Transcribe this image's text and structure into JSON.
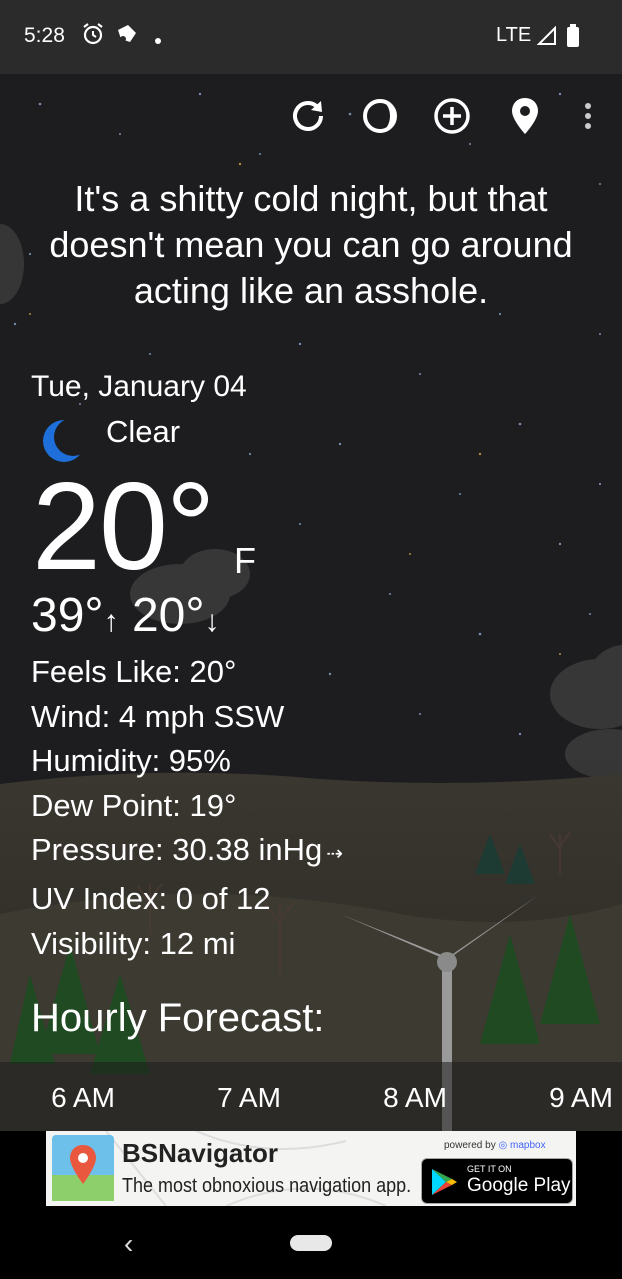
{
  "status_bar": {
    "time": "5:28",
    "network": "LTE",
    "icons": [
      "alarm-icon",
      "cast-icon",
      "dot-icon",
      "signal-icon",
      "battery-icon"
    ]
  },
  "toolbar": {
    "icons": [
      "refresh-icon",
      "theme-icon",
      "add-location-icon",
      "location-pin-icon",
      "more-vert-icon"
    ]
  },
  "quote": "It's a shitty cold night, but that doesn't mean you can go around acting like an asshole.",
  "current": {
    "date": "Tue, January 04",
    "condition": "Clear",
    "condition_icon": "moon-icon",
    "temperature": "20°",
    "unit": "F",
    "high": "39°",
    "low": "20°"
  },
  "details": [
    "Feels Like:  20°",
    "Wind:  4 mph SSW",
    "Humidity:  95%",
    "Dew Point:  19°",
    "Pressure:  30.38 inHg",
    "UV Index:  0 of 12",
    "Visibility:  12 mi"
  ],
  "pressure_trend_icon": "arrow-right-icon",
  "hourly": {
    "title": "Hourly Forecast:",
    "hours": [
      "6 AM",
      "7 AM",
      "8 AM",
      "9 AM"
    ]
  },
  "ad": {
    "name": "BSNavigator",
    "tagline": "The most obnoxious navigation app.",
    "powered_by": "powered by",
    "mapbox": "mapbox",
    "play_small": "GET IT ON",
    "play_big": "Google Play"
  },
  "colors": {
    "status_bar": "#2b2b2b",
    "sky": "#1d1d1f",
    "moon": "#1e6fd9",
    "ad_bg": "#f4f4f2"
  }
}
